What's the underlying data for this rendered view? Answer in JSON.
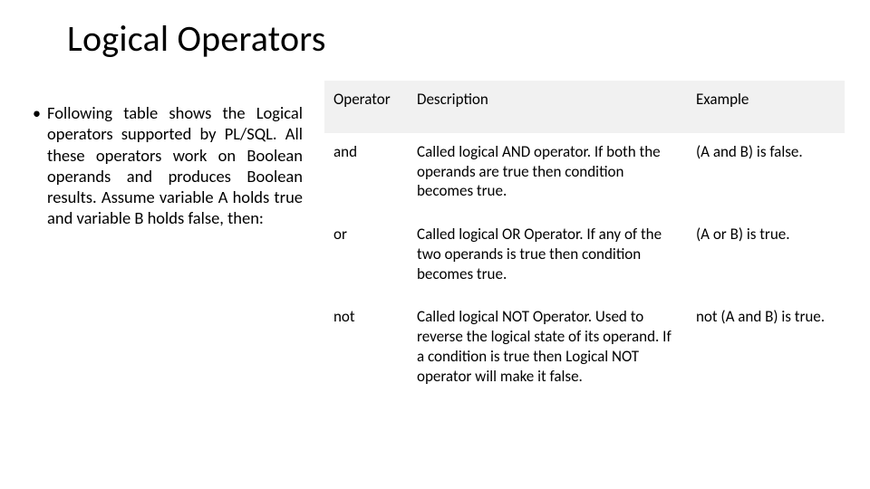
{
  "title": "Logical Operators",
  "bullet": "Following table shows the Logical operators supported by PL/SQL. All these operators work on Boolean operands and produces Boolean results. Assume variable A holds true and variable B holds false, then:",
  "table": {
    "headers": {
      "operator": "Operator",
      "description": "Description",
      "example": "Example"
    },
    "rows": [
      {
        "operator": "and",
        "description": "Called logical AND operator. If both the operands are true then condition becomes true.",
        "example": "(A and B) is false."
      },
      {
        "operator": "or",
        "description": "Called logical OR Operator. If any of the two operands is true then condition becomes true.",
        "example": "(A or B) is true."
      },
      {
        "operator": "not",
        "description": "Called logical NOT Operator. Used to reverse the logical state of its operand. If a condition is true then Logical NOT operator will make it false.",
        "example": "not (A and B) is true."
      }
    ]
  }
}
